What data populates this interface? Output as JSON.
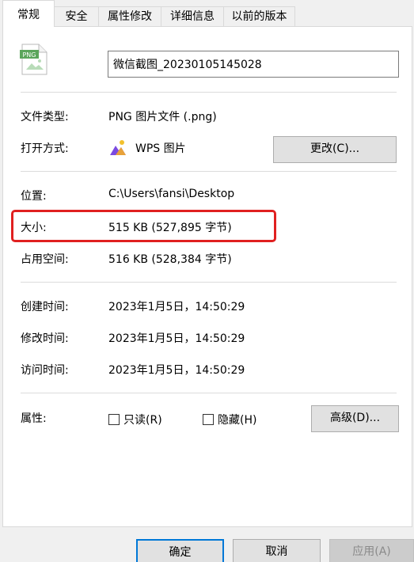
{
  "tabs": [
    {
      "label": "常规"
    },
    {
      "label": "安全"
    },
    {
      "label": "属性修改"
    },
    {
      "label": "详细信息"
    },
    {
      "label": "以前的版本"
    }
  ],
  "file": {
    "name": "微信截图_20230105145028",
    "icon_text": "PNG"
  },
  "type": {
    "label": "文件类型:",
    "value": "PNG 图片文件 (.png)"
  },
  "open_with": {
    "label": "打开方式:",
    "app": "WPS 图片",
    "change_button": "更改(C)..."
  },
  "location": {
    "label": "位置:",
    "value": "C:\\Users\\fansi\\Desktop"
  },
  "size": {
    "label": "大小:",
    "value": "515 KB (527,895 字节)"
  },
  "size_on_disk": {
    "label": "占用空间:",
    "value": "516 KB (528,384 字节)"
  },
  "created": {
    "label": "创建时间:",
    "value": "2023年1月5日，14:50:29"
  },
  "modified": {
    "label": "修改时间:",
    "value": "2023年1月5日，14:50:29"
  },
  "accessed": {
    "label": "访问时间:",
    "value": "2023年1月5日，14:50:29"
  },
  "attributes": {
    "label": "属性:",
    "readonly": "只读(R)",
    "readonly_checked": false,
    "hidden": "隐藏(H)",
    "hidden_checked": false,
    "advanced_button": "高级(D)..."
  },
  "buttons": {
    "ok": "确定",
    "cancel": "取消",
    "apply": "应用(A)"
  },
  "colors": {
    "highlight_border": "#e02020",
    "default_button_border": "#0078d7"
  }
}
